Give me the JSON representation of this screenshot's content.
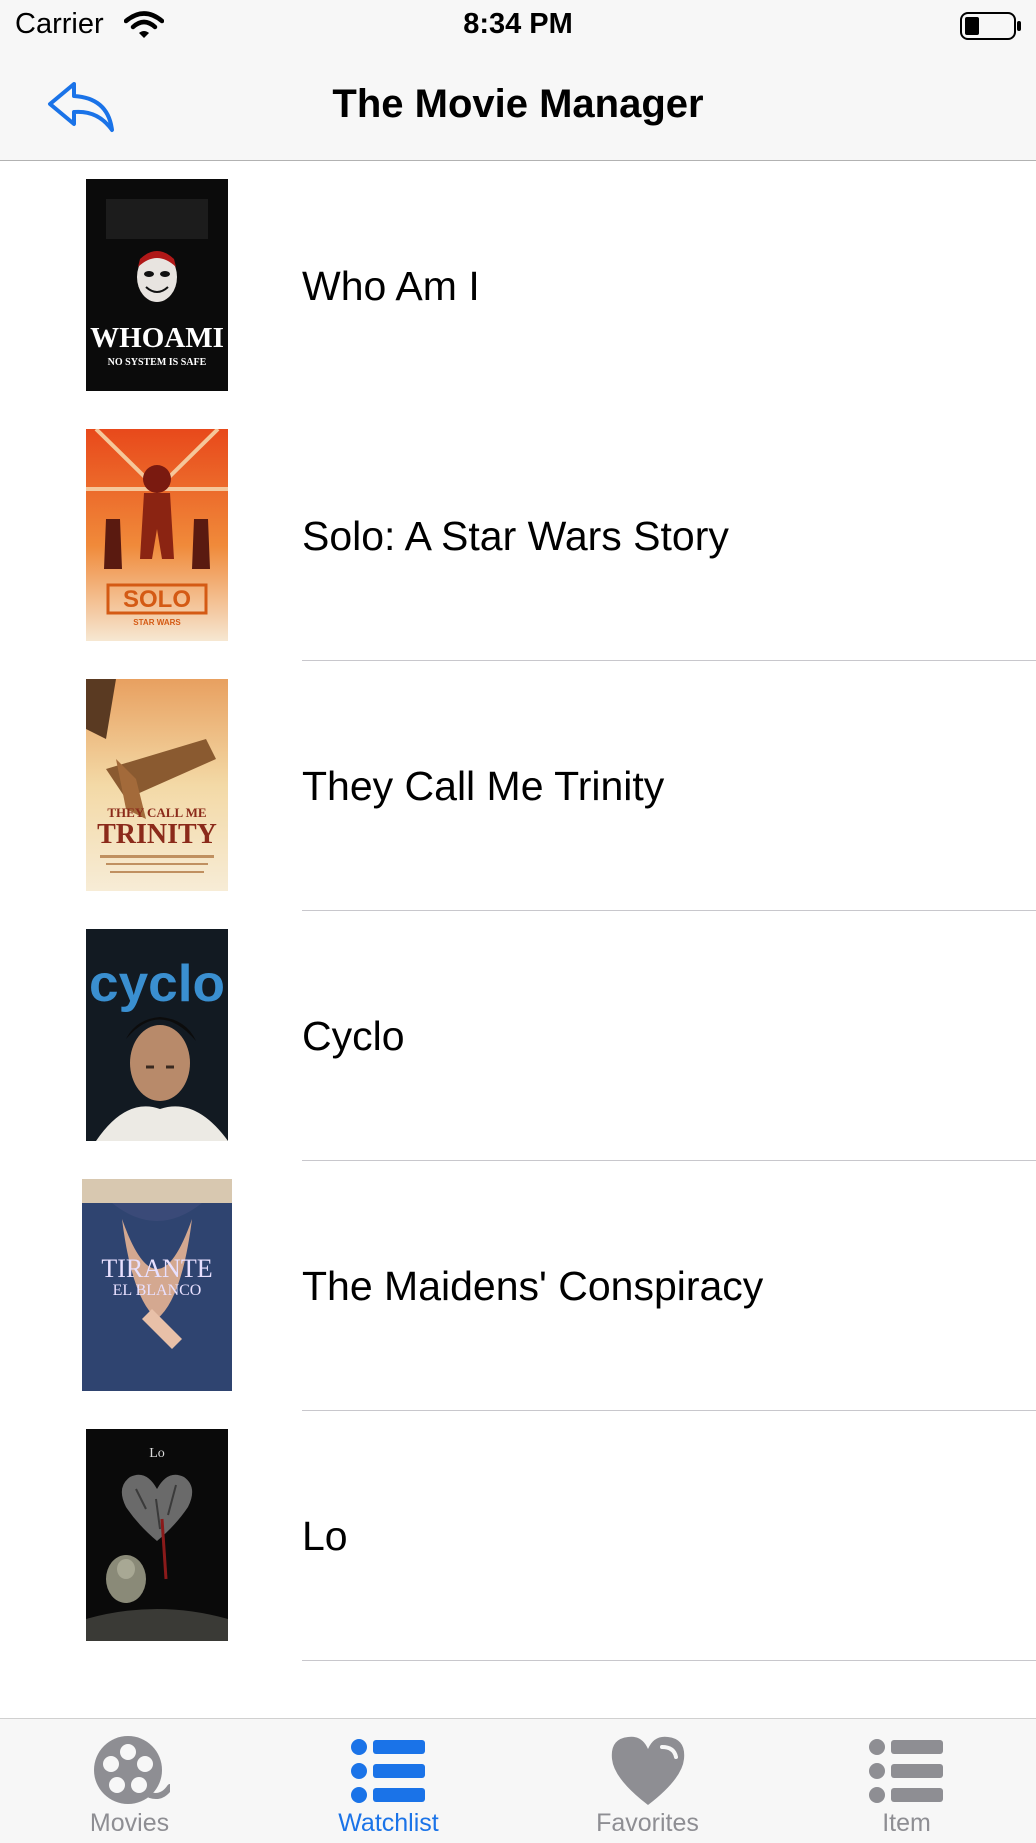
{
  "status_bar": {
    "carrier": "Carrier",
    "time": "8:34 PM"
  },
  "nav": {
    "title": "The Movie Manager"
  },
  "movies": [
    {
      "title": "Who Am I",
      "poster_text": "WHOAMI",
      "poster_tagline": "NO SYSTEM IS SAFE"
    },
    {
      "title": "Solo: A Star Wars Story",
      "poster_text": "SOLO",
      "poster_tagline": "STAR WARS"
    },
    {
      "title": "They Call Me Trinity",
      "poster_text": "THEY CALL ME",
      "poster_tagline": "TRINITY"
    },
    {
      "title": "Cyclo",
      "poster_text": "cyclo"
    },
    {
      "title": "The Maidens' Conspiracy",
      "poster_text": "TIRANTE",
      "poster_tagline": "EL BLANCO"
    },
    {
      "title": "Lo",
      "poster_text": "Lo"
    }
  ],
  "tabs": [
    {
      "label": "Movies",
      "icon": "film-reel-icon"
    },
    {
      "label": "Watchlist",
      "icon": "list-icon"
    },
    {
      "label": "Favorites",
      "icon": "heart-icon"
    },
    {
      "label": "Item",
      "icon": "list-icon"
    }
  ],
  "colors": {
    "accent": "#1a73e8",
    "inactive": "#8e8e93"
  }
}
